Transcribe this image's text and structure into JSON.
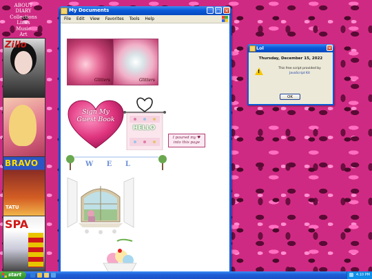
{
  "left_nav": {
    "links": [
      "ABOUT",
      "DIARY",
      "Collections",
      "Links",
      "Music",
      "Art"
    ]
  },
  "magazines": [
    {
      "title": "Zillo",
      "subtitle": ""
    },
    {
      "title": "",
      "subtitle": ""
    },
    {
      "title": "BRAVO",
      "subtitle": "TATU"
    },
    {
      "title": "SPA",
      "subtitle": ""
    }
  ],
  "explorer_window": {
    "title": "My Documents",
    "menu": [
      "File",
      "Edit",
      "View",
      "Favorites",
      "Tools",
      "Help"
    ],
    "content": {
      "watermark": "Glitters",
      "guestbook_text": "Sign My Guest Book",
      "banner_text": "HELLO",
      "poured_text": "I poured my ♥ into this page",
      "welcome_text": "W E L"
    }
  },
  "message_box": {
    "title": "Lol",
    "date": "Thursday, December 15, 2022",
    "line1": "This free script provided by",
    "line2": "JavaScript Kit",
    "ok_label": "OK"
  },
  "taskbar": {
    "start_label": "start",
    "clock": "4:10 PM"
  },
  "colors": {
    "xp_blue": "#0a59d6",
    "start_green": "#3a9a30",
    "desktop_pink": "#cf2a83"
  }
}
